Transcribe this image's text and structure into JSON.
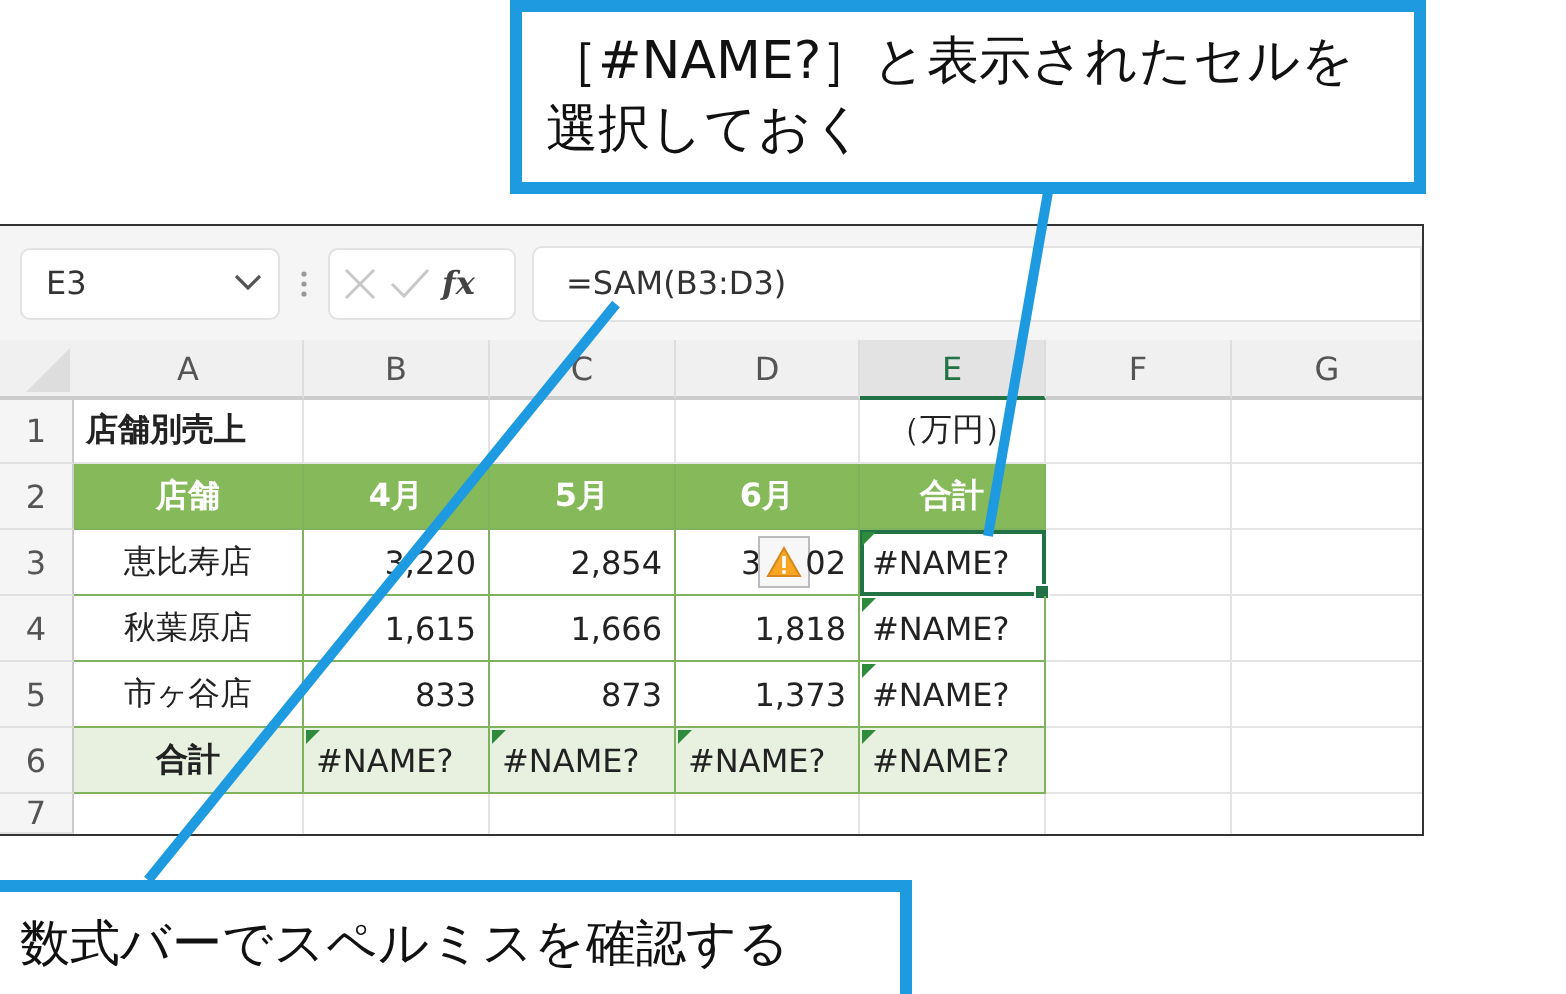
{
  "callouts": [
    {
      "kind": "top",
      "lines": [
        "［#NAME?］と表示されたセルを",
        "選択しておく"
      ]
    },
    {
      "kind": "bottom",
      "lines": [
        "数式バーでスペルミスを確認する"
      ]
    }
  ],
  "spreadsheet": {
    "name_box": "E3",
    "fx": "fx",
    "formula": "=SAM(B3:D3)",
    "columns": [
      {
        "label": "A",
        "selected": false
      },
      {
        "label": "B",
        "selected": false
      },
      {
        "label": "C",
        "selected": false
      },
      {
        "label": "D",
        "selected": false
      },
      {
        "label": "E",
        "selected": true
      },
      {
        "label": "F",
        "selected": false
      },
      {
        "label": "G",
        "selected": false
      }
    ],
    "rows": [
      {
        "label": "1",
        "kind": "plain",
        "cells": [
          {
            "kind": "title",
            "text": "店舗別売上"
          },
          {
            "kind": "empty"
          },
          {
            "kind": "empty"
          },
          {
            "kind": "empty"
          },
          {
            "kind": "unit",
            "text": "（万円）"
          },
          {
            "kind": "empty"
          },
          {
            "kind": "empty"
          }
        ]
      },
      {
        "label": "2",
        "kind": "header",
        "cells": [
          {
            "kind": "head",
            "text": "店舗"
          },
          {
            "kind": "head",
            "text": "4月"
          },
          {
            "kind": "head",
            "text": "5月"
          },
          {
            "kind": "head",
            "text": "6月"
          },
          {
            "kind": "head",
            "text": "合計"
          },
          {
            "kind": "empty"
          },
          {
            "kind": "empty"
          }
        ]
      },
      {
        "label": "3",
        "kind": "plain",
        "cells": [
          {
            "kind": "name",
            "text": "恵比寿店"
          },
          {
            "kind": "number",
            "text": "3,220"
          },
          {
            "kind": "number",
            "text": "2,854"
          },
          {
            "kind": "number",
            "text": "3",
            "warning": true,
            "text_after": "02"
          },
          {
            "kind": "error",
            "text": "#NAME?",
            "error_flag": true,
            "selected": true
          },
          {
            "kind": "empty"
          },
          {
            "kind": "empty"
          }
        ]
      },
      {
        "label": "4",
        "kind": "plain",
        "cells": [
          {
            "kind": "name",
            "text": "秋葉原店"
          },
          {
            "kind": "number",
            "text": "1,615"
          },
          {
            "kind": "number",
            "text": "1,666"
          },
          {
            "kind": "number",
            "text": "1,818"
          },
          {
            "kind": "error",
            "text": "#NAME?",
            "error_flag": true,
            "selected": false
          },
          {
            "kind": "empty"
          },
          {
            "kind": "empty"
          }
        ]
      },
      {
        "label": "5",
        "kind": "plain",
        "cells": [
          {
            "kind": "name",
            "text": "市ヶ谷店"
          },
          {
            "kind": "number",
            "text": "833"
          },
          {
            "kind": "number",
            "text": "873"
          },
          {
            "kind": "number",
            "text": "1,373"
          },
          {
            "kind": "error",
            "text": "#NAME?",
            "error_flag": true,
            "selected": false
          },
          {
            "kind": "empty"
          },
          {
            "kind": "empty"
          }
        ]
      },
      {
        "label": "6",
        "kind": "total",
        "cells": [
          {
            "kind": "total_label",
            "text": "合計"
          },
          {
            "kind": "error",
            "text": "#NAME?",
            "error_flag": true,
            "selected": false
          },
          {
            "kind": "error",
            "text": "#NAME?",
            "error_flag": true,
            "selected": false
          },
          {
            "kind": "error",
            "text": "#NAME?",
            "error_flag": true,
            "selected": false
          },
          {
            "kind": "error",
            "text": "#NAME?",
            "error_flag": true,
            "selected": false
          },
          {
            "kind": "empty"
          },
          {
            "kind": "empty"
          }
        ]
      },
      {
        "label": "7",
        "kind": "plain",
        "cells": [
          {
            "kind": "empty"
          },
          {
            "kind": "empty"
          },
          {
            "kind": "empty"
          },
          {
            "kind": "empty"
          },
          {
            "kind": "empty"
          },
          {
            "kind": "empty"
          },
          {
            "kind": "empty"
          }
        ]
      }
    ]
  }
}
